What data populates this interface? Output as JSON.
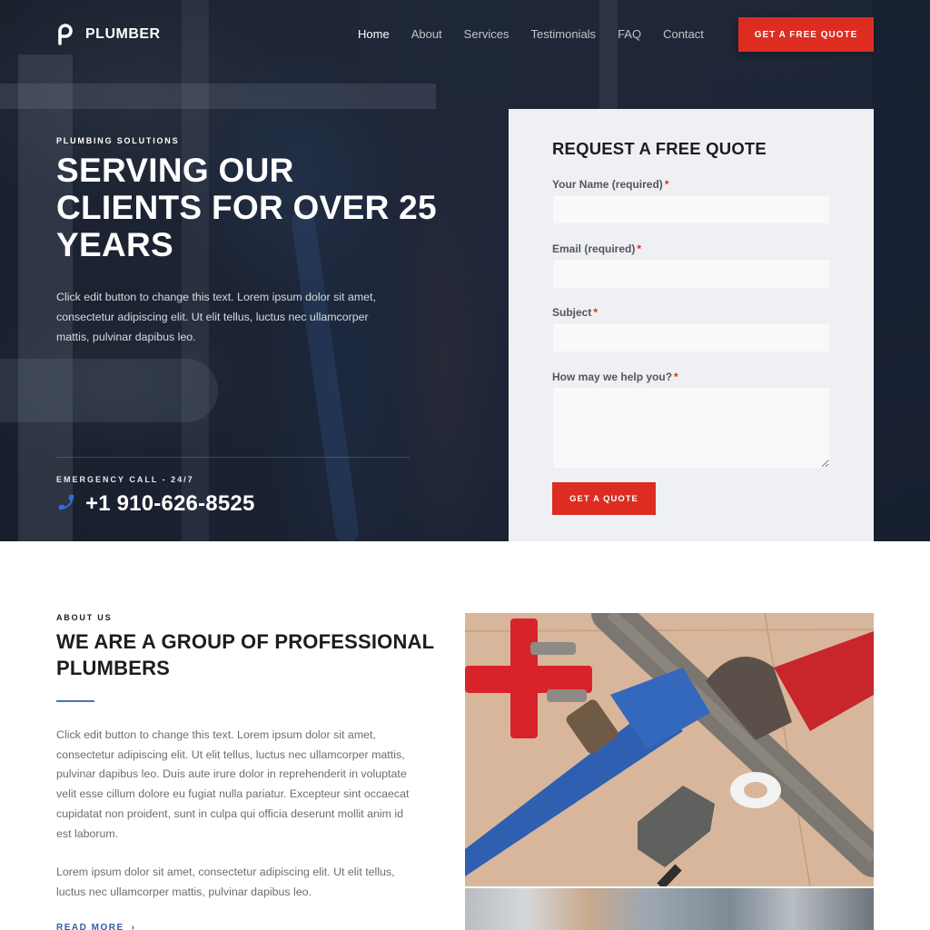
{
  "header": {
    "brand": "PLUMBER",
    "logo_icon": "p-logo-icon",
    "nav": [
      {
        "label": "Home",
        "active": true
      },
      {
        "label": "About",
        "active": false
      },
      {
        "label": "Services",
        "active": false
      },
      {
        "label": "Testimonials",
        "active": false
      },
      {
        "label": "FAQ",
        "active": false
      },
      {
        "label": "Contact",
        "active": false
      }
    ],
    "cta_label": "GET A FREE QUOTE"
  },
  "hero": {
    "kicker": "PLUMBING SOLUTIONS",
    "title": "SERVING OUR CLIENTS FOR OVER 25 YEARS",
    "body": "Click edit button to change this text. Lorem ipsum dolor sit amet, consectetur adipiscing elit. Ut elit tellus, luctus nec ullamcorper mattis, pulvinar dapibus leo.",
    "emergency_label": "EMERGENCY CALL - 24/7",
    "phone_icon": "phone-icon",
    "phone": "+1 910-626-8525"
  },
  "quote_form": {
    "title": "REQUEST A FREE QUOTE",
    "fields": [
      {
        "label": "Your Name (required)",
        "required_mark": "*",
        "value": "",
        "placeholder": ""
      },
      {
        "label": "Email (required)",
        "required_mark": "*",
        "value": "",
        "placeholder": ""
      },
      {
        "label": "Subject",
        "required_mark": "*",
        "value": "",
        "placeholder": ""
      },
      {
        "label": "How may we help you?",
        "required_mark": "*",
        "value": "",
        "placeholder": ""
      }
    ],
    "submit_label": "GET A QUOTE"
  },
  "about": {
    "kicker": "ABOUT US",
    "title": "WE ARE A GROUP OF PROFESSIONAL PLUMBERS",
    "paragraph1": "Click edit button to change this text. Lorem ipsum dolor sit amet, consectetur adipiscing elit. Ut elit tellus, luctus nec ullamcorper mattis, pulvinar dapibus leo. Duis aute irure dolor in reprehenderit in voluptate velit esse cillum dolore eu fugiat nulla pariatur. Excepteur sint occaecat cupidatat non proident, sunt in culpa qui officia deserunt mollit anim id est laborum.",
    "paragraph2": "Lorem ipsum dolor sit amet, consectetur adipiscing elit. Ut elit tellus, luctus nec ullamcorper mattis, pulvinar dapibus leo.",
    "read_more": "READ MORE",
    "read_more_arrow": "›",
    "photo_main_alt": "pipe wrenches on pipe",
    "photo_second_alt": "plumber at sink"
  },
  "colors": {
    "accent_red": "#dd2d21",
    "accent_blue": "#4a74b8",
    "phone_icon_blue": "#2f6fe0",
    "hero_overlay": "#1f2838",
    "form_bg": "#eef0f3"
  }
}
